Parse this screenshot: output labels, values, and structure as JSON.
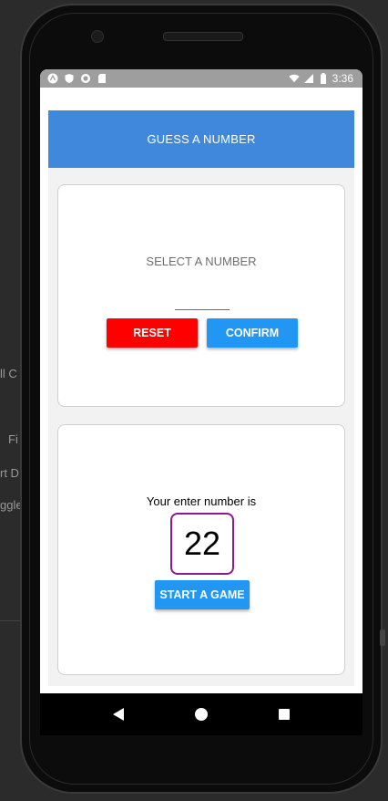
{
  "background": {
    "items": [
      "ll C",
      "Fi",
      "rt D",
      "ggle"
    ]
  },
  "statusbar": {
    "time": "3:36",
    "left_icons": [
      "android-icon",
      "shield-icon",
      "circle-icon",
      "sdcard-icon"
    ],
    "right_icons": [
      "wifi-icon",
      "signal-icon",
      "battery-icon"
    ]
  },
  "header": {
    "title": "GUESS A NUMBER"
  },
  "select_card": {
    "label": "SELECT A NUMBER",
    "input_value": "",
    "reset_label": "RESET",
    "confirm_label": "CONFIRM"
  },
  "result_card": {
    "label": "Your enter number is",
    "number": "22",
    "start_label": "START A GAME"
  },
  "navbar": {
    "icons": [
      "back-icon",
      "home-icon",
      "recents-icon"
    ]
  },
  "colors": {
    "header": "#3f88dc",
    "reset": "#ff0000",
    "confirm": "#2196f3",
    "number_border": "#8b1a8e",
    "statusbar": "#9e9e9e"
  }
}
